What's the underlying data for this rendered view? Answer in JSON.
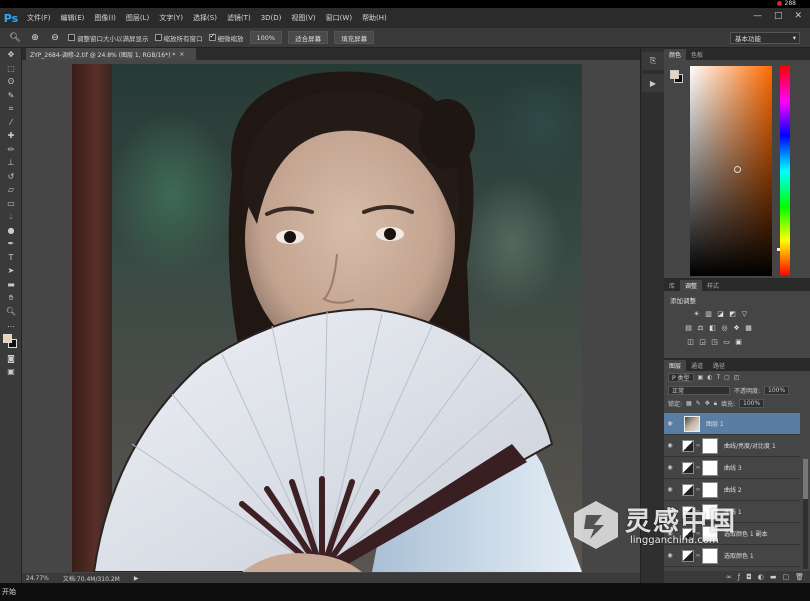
{
  "titlebar": {
    "rec_label": "288"
  },
  "menubar": {
    "logo": "Ps",
    "items": [
      "文件(F)",
      "编辑(E)",
      "图像(I)",
      "图层(L)",
      "文字(Y)",
      "选择(S)",
      "滤镜(T)",
      "3D(D)",
      "视图(V)",
      "窗口(W)",
      "帮助(H)"
    ],
    "window_controls": [
      "—",
      "□",
      "✕"
    ]
  },
  "optionsbar": {
    "resize_windows_label": "调整窗口大小以满屏显示",
    "zoom_all_label": "缩放所有窗口",
    "scrubby_zoom_label": "细微缩放",
    "zoom_percent_button": "100%",
    "fit_screen_button": "适合屏幕",
    "fill_screen_button": "填充屏幕",
    "workspace": "基本功能"
  },
  "document": {
    "tab_title": "ZYP_2684-调修-2.tif @ 24.8% (图层 1, RGB/16*) *",
    "close": "×"
  },
  "statusbar": {
    "zoom": "24.77%",
    "doc_info": "文档:70.4M/310.2M",
    "arrow": "▶"
  },
  "taskbar": {
    "text": "开始"
  },
  "panels": {
    "color": {
      "tabs": [
        "颜色",
        "色板"
      ],
      "fg_color": "#e8d2b8",
      "bg_color": "#111111"
    },
    "adjustments": {
      "tabs": [
        "库",
        "调整",
        "样式"
      ],
      "label": "添加调整"
    },
    "layers": {
      "tabs": [
        "图层",
        "通道",
        "路径"
      ],
      "filter_kind": "P 类型",
      "blend_mode": "正常",
      "opacity_label": "不透明度:",
      "opacity_value": "100%",
      "lock_label": "锁定:",
      "fill_label": "填充:",
      "fill_value": "100%",
      "items": [
        {
          "name": "图层 1",
          "selected": true
        },
        {
          "name": "曲线/亮度/对比度 1",
          "selected": false
        },
        {
          "name": "曲线 3",
          "selected": false
        },
        {
          "name": "曲线 2",
          "selected": false
        },
        {
          "name": "曲线 1",
          "selected": false
        },
        {
          "name": "选取颜色 1 副本",
          "selected": false
        },
        {
          "name": "选取颜色 1",
          "selected": false
        }
      ]
    }
  },
  "watermark": {
    "cn": "灵感中国",
    "en": "lingganchina.com"
  }
}
